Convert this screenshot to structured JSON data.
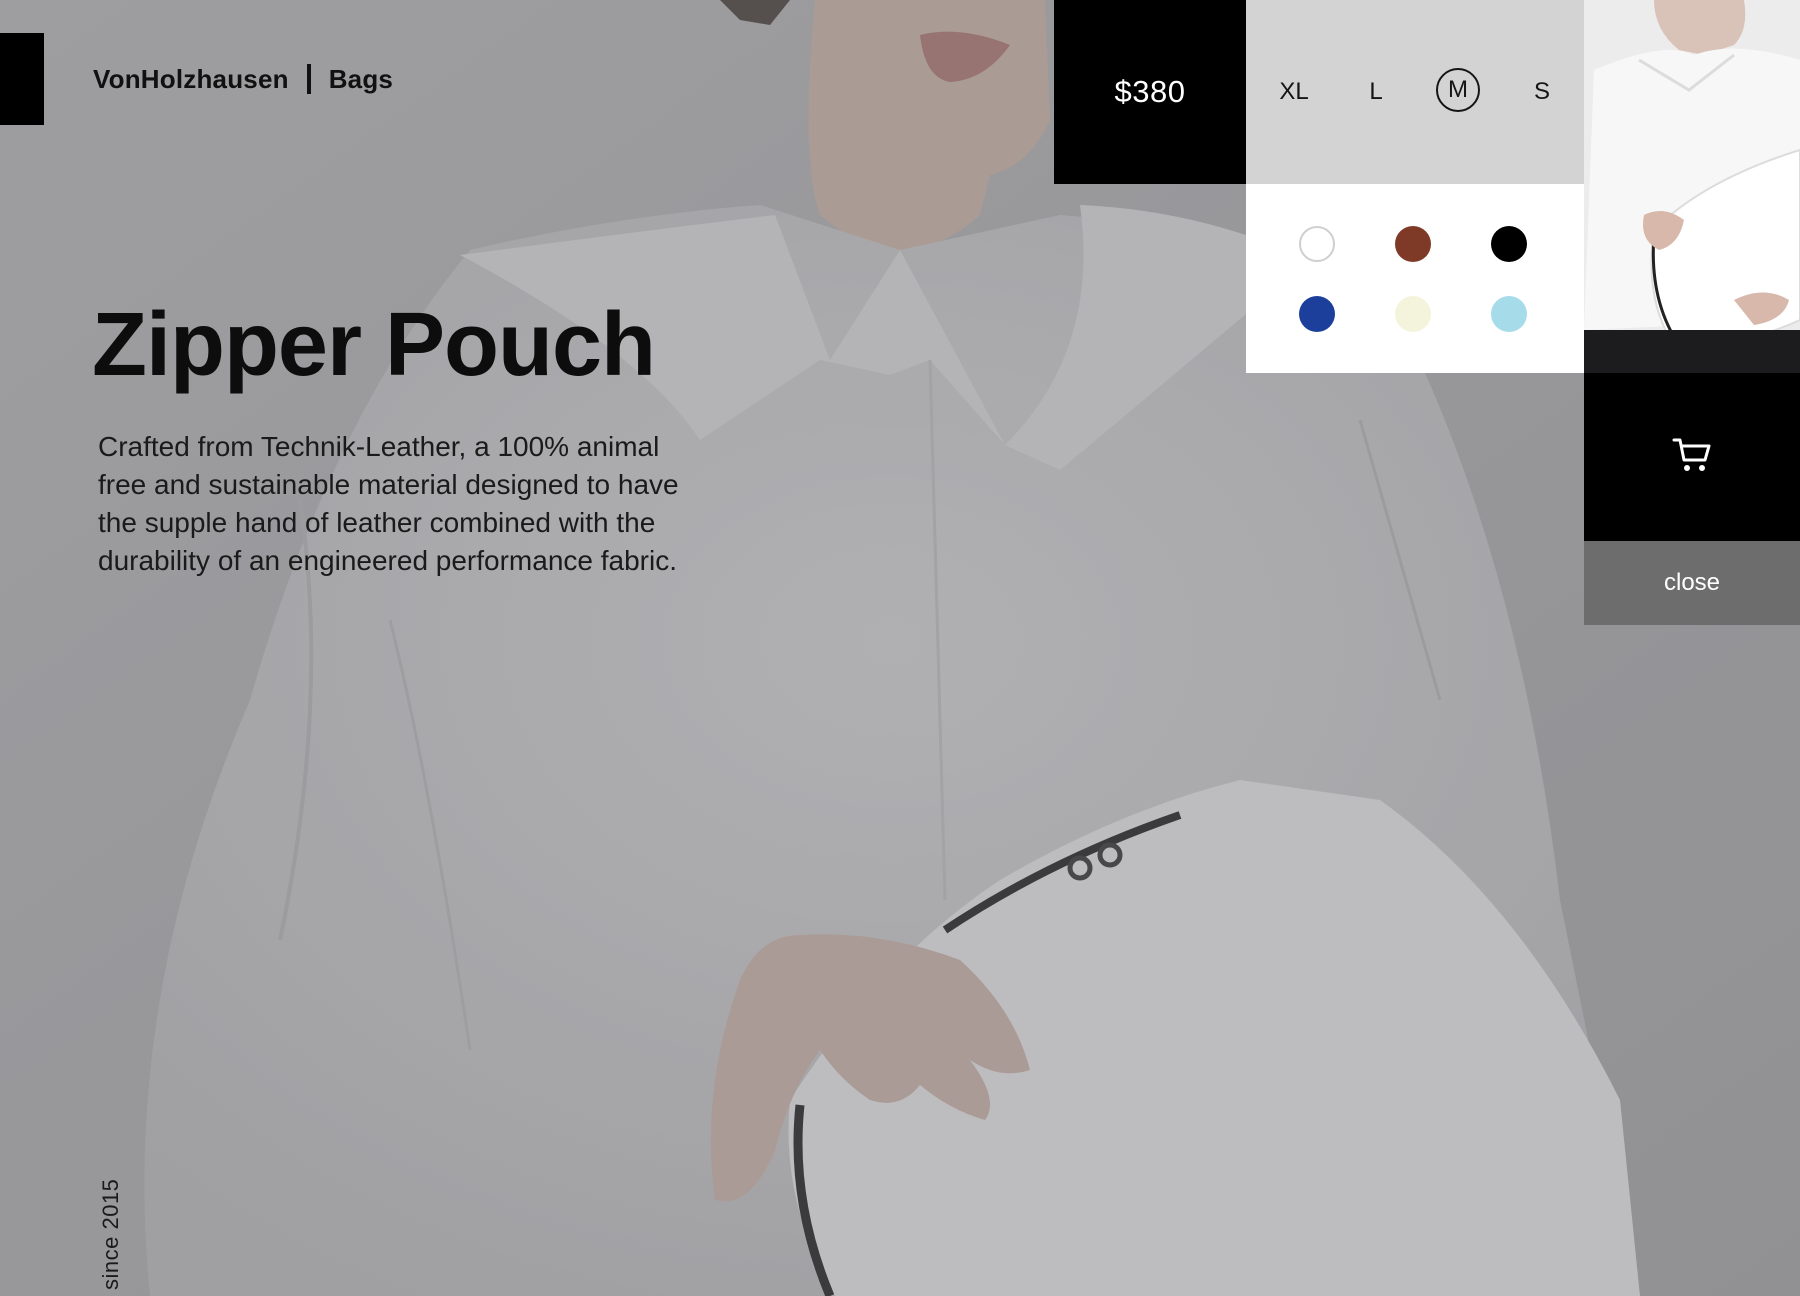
{
  "brand": {
    "name": "VonHolzhausen",
    "category": "Bags"
  },
  "product": {
    "title": "Zipper Pouch",
    "description": "Crafted from Technik-Leather, a 100% animal free and sustainable material designed to have the supple hand of leather combined with the durability of an engineered performance fabric.",
    "price": "$380"
  },
  "sizes": {
    "options": [
      {
        "label": "XL"
      },
      {
        "label": "L"
      },
      {
        "label": "M",
        "selected": true
      },
      {
        "label": "S"
      }
    ]
  },
  "colors": {
    "options": [
      {
        "name": "white",
        "hex": "#ffffff"
      },
      {
        "name": "brown",
        "hex": "#7e3a27"
      },
      {
        "name": "black",
        "hex": "#000000"
      },
      {
        "name": "navy-blue",
        "hex": "#1b3f9a"
      },
      {
        "name": "cream",
        "hex": "#f4f4dc"
      },
      {
        "name": "light-blue",
        "hex": "#a6dbea"
      }
    ]
  },
  "actions": {
    "cart_icon": "cart-icon",
    "close_label": "close"
  },
  "footer": {
    "since": "since 2015"
  }
}
